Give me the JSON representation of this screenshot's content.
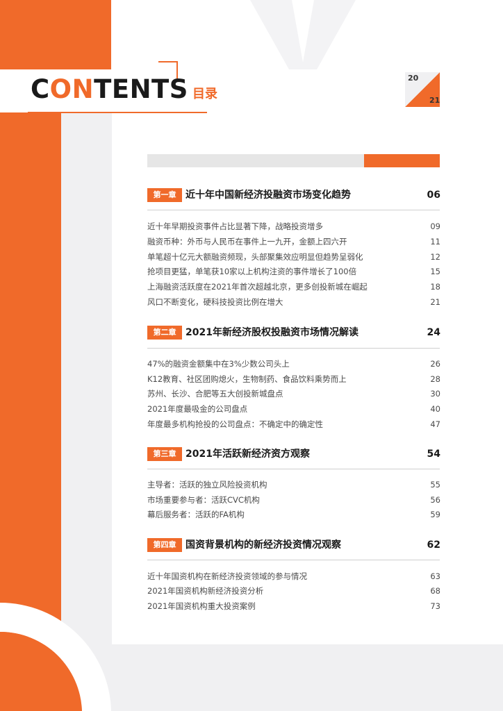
{
  "header": {
    "title_part1": "C",
    "title_part2": "ON",
    "title_part3": "TENTS",
    "title_zh": "目录",
    "page_left": "20",
    "page_right": "21"
  },
  "colors": {
    "accent": "#f06a2a",
    "text": "#1a1a1a",
    "muted": "#4a4a4a",
    "panel": "#f0f0f2"
  },
  "chapters": [
    {
      "badge": "第一章",
      "title": "近十年中国新经济投融资市场变化趋势",
      "page": "06",
      "items": [
        {
          "title": "近十年早期投资事件占比显著下降，战略投资增多",
          "page": "09"
        },
        {
          "title": "融资币种：外币与人民币在事件上一九开，金额上四六开",
          "page": "11"
        },
        {
          "title": "单笔超十亿元大额融资频现，头部聚集效应明显但趋势呈弱化",
          "page": "12"
        },
        {
          "title": "抢项目更猛，单笔获10家以上机构注资的事件增长了100倍",
          "page": "15"
        },
        {
          "title": "上海融资活跃度在2021年首次超越北京，更多创投新城在崛起",
          "page": "18"
        },
        {
          "title": "风口不断变化，硬科技投资比例在增大",
          "page": "21"
        }
      ]
    },
    {
      "badge": "第二章",
      "title": "2021年新经济股权投融资市场情况解读",
      "page": "24",
      "items": [
        {
          "title": "47%的融资金额集中在3%少数公司头上",
          "page": "26"
        },
        {
          "title": "K12教育、社区团购熄火，生物制药、食品饮料乘势而上",
          "page": "28"
        },
        {
          "title": "苏州、长沙、合肥等五大创投新城盘点",
          "page": "30"
        },
        {
          "title": "2021年度最吸金的公司盘点",
          "page": "40"
        },
        {
          "title": "年度最多机构抢投的公司盘点：不确定中的确定性",
          "page": "47"
        }
      ]
    },
    {
      "badge": "第三章",
      "title": "2021年活跃新经济资方观察",
      "page": "54",
      "items": [
        {
          "title": "主导者：活跃的独立风险投资机构",
          "page": "55"
        },
        {
          "title": "市场重要参与者：活跃CVC机构",
          "page": "56"
        },
        {
          "title": "幕后服务者：活跃的FA机构",
          "page": "59"
        }
      ]
    },
    {
      "badge": "第四章",
      "title": "国资背景机构的新经济投资情况观察",
      "page": "62",
      "items": [
        {
          "title": "近十年国资机构在新经济投资领域的参与情况",
          "page": "63"
        },
        {
          "title": "2021年国资机构新经济投资分析",
          "page": "68"
        },
        {
          "title": "2021年国资机构重大投资案例",
          "page": "73"
        }
      ]
    }
  ]
}
